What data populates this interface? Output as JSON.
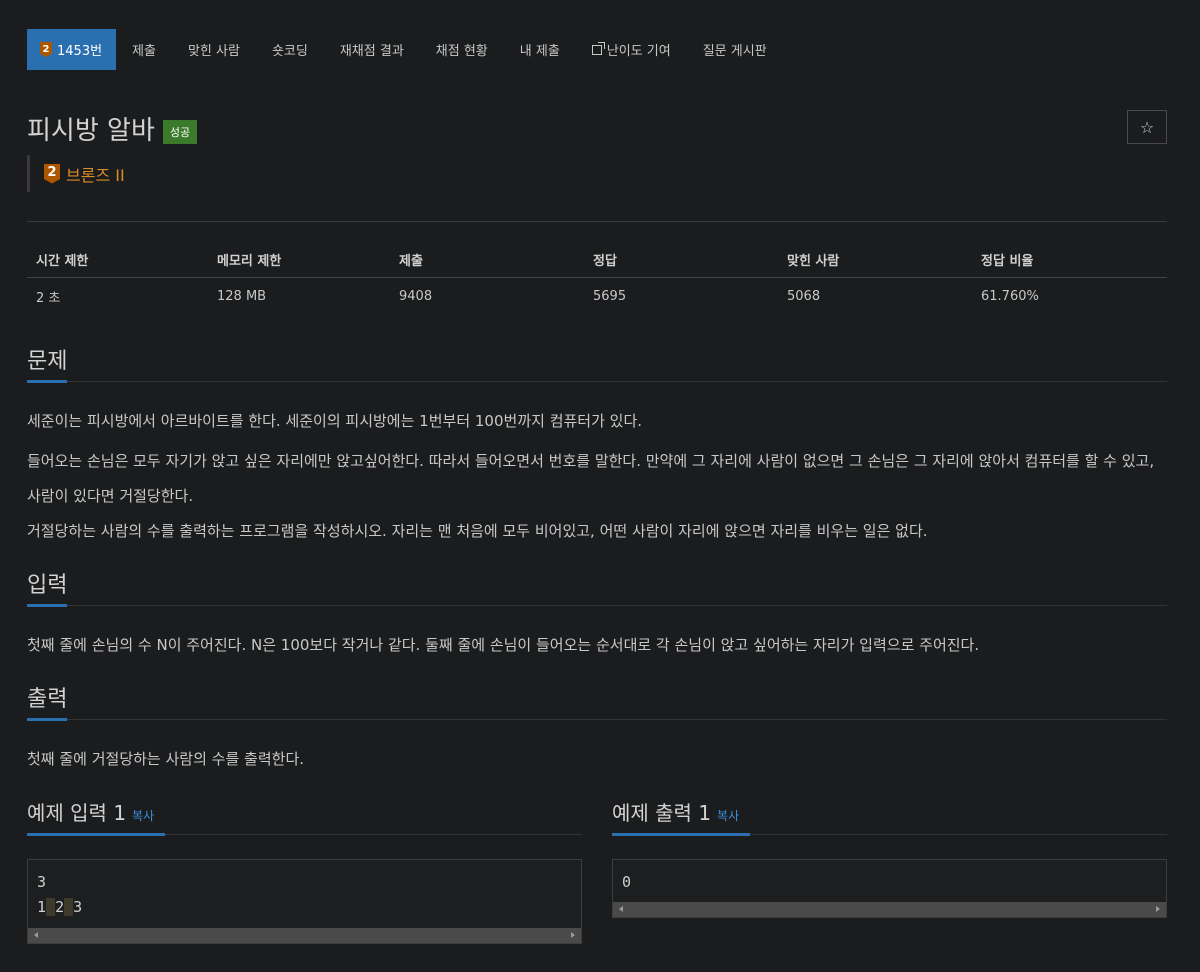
{
  "tabs": [
    {
      "label": "1453번",
      "tier": "2"
    },
    {
      "label": "제출"
    },
    {
      "label": "맞힌 사람"
    },
    {
      "label": "숏코딩"
    },
    {
      "label": "재채점 결과"
    },
    {
      "label": "채점 현황"
    },
    {
      "label": "내 제출"
    },
    {
      "label": "난이도 기여"
    },
    {
      "label": "질문 게시판"
    }
  ],
  "title": "피시방 알바",
  "status_badge": "성공",
  "star": "☆",
  "tier": {
    "level": "2",
    "label": "브론즈 II",
    "color": "#ad5600"
  },
  "stats": {
    "headers": [
      "시간 제한",
      "메모리 제한",
      "제출",
      "정답",
      "맞힌 사람",
      "정답 비율"
    ],
    "values": [
      "2 초",
      "128 MB",
      "9408",
      "5695",
      "5068",
      "61.760%"
    ]
  },
  "sections": {
    "problem": {
      "heading": "문제",
      "paragraphs": [
        "세준이는 피시방에서 아르바이트를 한다. 세준이의 피시방에는 1번부터 100번까지 컴퓨터가 있다.",
        "들어오는 손님은 모두 자기가 앉고 싶은 자리에만 앉고싶어한다. 따라서 들어오면서 번호를 말한다. 만약에 그 자리에 사람이 없으면 그 손님은 그 자리에 앉아서 컴퓨터를 할 수 있고, 사람이 있다면 거절당한다.",
        "거절당하는 사람의 수를 출력하는 프로그램을 작성하시오. 자리는 맨 처음에 모두 비어있고, 어떤 사람이 자리에 앉으면 자리를 비우는 일은 없다."
      ]
    },
    "input": {
      "heading": "입력",
      "text": "첫째 줄에 손님의 수 N이 주어진다. N은 100보다 작거나 같다. 둘째 줄에 손님이 들어오는 순서대로 각 손님이 앉고 싶어하는 자리가 입력으로 주어진다."
    },
    "output": {
      "heading": "출력",
      "text": "첫째 줄에 거절당하는 사람의 수를 출력한다."
    }
  },
  "examples": {
    "input": {
      "heading": "예제 입력 1",
      "copy": "복사",
      "line1": "3",
      "line2": [
        "1",
        "2",
        "3"
      ]
    },
    "output": {
      "heading": "예제 출력 1",
      "copy": "복사",
      "line1": "0"
    }
  },
  "colors": {
    "accent": "#2a6fb0",
    "success": "#3b7a2a",
    "bronze": "#ad5600",
    "tier_text": "#d98b2b",
    "link": "#3d8ee0"
  },
  "icons": [
    "tier-bronze-icon",
    "external-link-icon",
    "star-icon",
    "scroll-left-arrow-icon",
    "scroll-right-arrow-icon"
  ]
}
